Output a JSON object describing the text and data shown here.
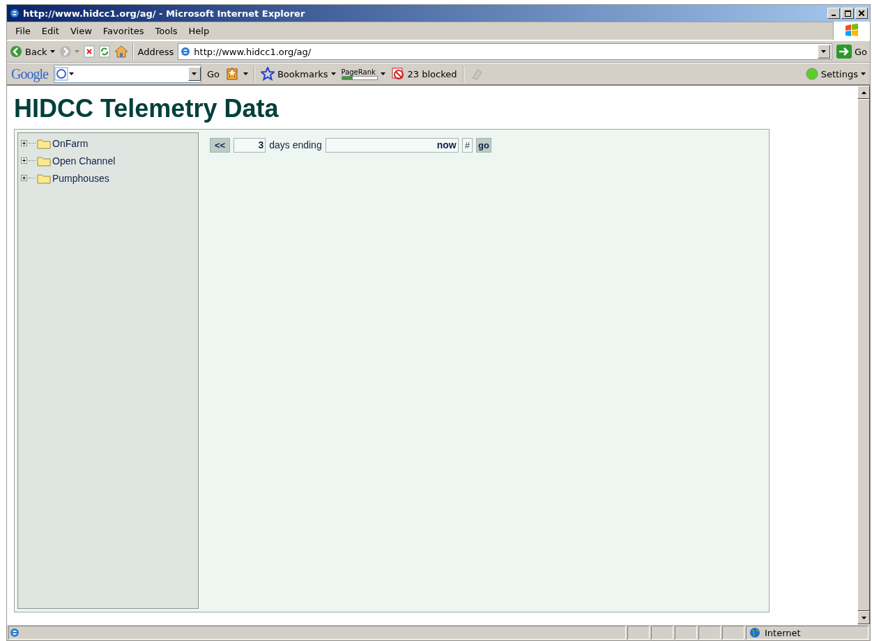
{
  "window": {
    "title": "http://www.hidcc1.org/ag/ - Microsoft Internet Explorer"
  },
  "menu_bar": [
    {
      "label": "File"
    },
    {
      "label": "Edit"
    },
    {
      "label": "View"
    },
    {
      "label": "Favorites"
    },
    {
      "label": "Tools"
    },
    {
      "label": "Help"
    }
  ],
  "toolbar": {
    "back": "Back",
    "address_label": "Address",
    "address": "http://www.hidcc1.org/ag/",
    "go": "Go"
  },
  "google_toolbar": {
    "logo": "Google",
    "go": "Go",
    "bookmarks": "Bookmarks",
    "pagerank": {
      "label": "PageRank",
      "level": 0.3
    },
    "blocked": "23 blocked",
    "settings": "Settings"
  },
  "page": {
    "heading": "HIDCC Telemetry Data",
    "tree": [
      {
        "label": "OnFarm",
        "expanded": false
      },
      {
        "label": "Open Channel",
        "expanded": false
      },
      {
        "label": "Pumphouses",
        "expanded": false
      }
    ],
    "controls": {
      "previous": "<<",
      "days": "3",
      "days_label": "days ending",
      "ending": "now",
      "hash": "#",
      "go": "go"
    }
  },
  "status_bar": {
    "zone": "Internet"
  }
}
